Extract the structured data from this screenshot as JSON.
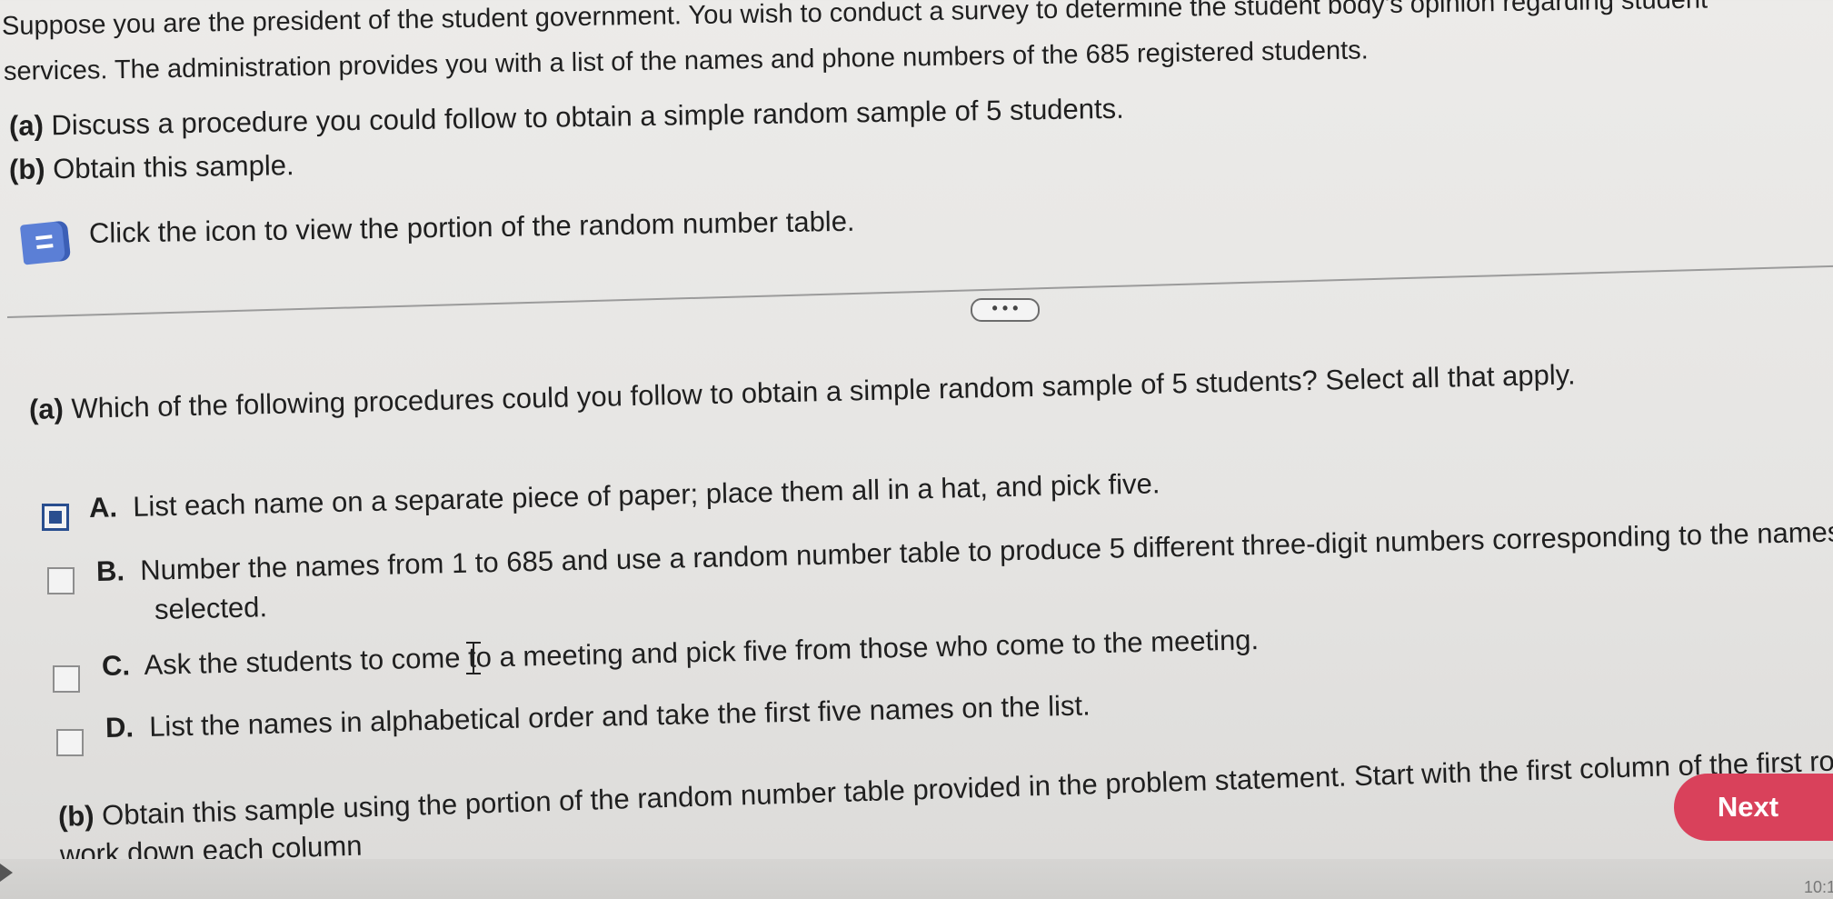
{
  "problem": {
    "line1": "Suppose you are the president of the student government. You wish to conduct a survey to determine the student body's opinion regarding student",
    "line2": "services. The administration provides you with a list of the names and phone numbers of the 685 registered students.",
    "part_a_label": "(a)",
    "part_a_text": "Discuss a procedure you could follow to obtain a simple random sample of 5 students.",
    "part_b_label": "(b)",
    "part_b_text": "Obtain this sample.",
    "icon_prompt": "Click the icon to view the portion of the random number table."
  },
  "divider": {
    "ellipsis": "• • •"
  },
  "question_a": {
    "label": "(a)",
    "text": "Which of the following procedures could you follow to obtain a simple random sample of 5 students? Select all that apply."
  },
  "options": [
    {
      "letter": "A.",
      "text": "List each name on a separate piece of paper; place them all in a hat, and pick five.",
      "checked": true
    },
    {
      "letter": "B.",
      "text_line1": "Number the names from 1 to 685 and use a random number table to produce 5 different three-digit numbers corresponding to the names",
      "text_line2": "selected.",
      "checked": false
    },
    {
      "letter": "C.",
      "text": "Ask the students to come to a meeting and pick five from those who come to the meeting.",
      "checked": false
    },
    {
      "letter": "D.",
      "text": "List the names in alphabetical order and take the first five names on the list.",
      "checked": false
    }
  ],
  "question_b": {
    "label": "(b)",
    "text_line1": "Obtain this sample using the portion of the random number table provided in the problem statement. Start with the first column of the first row and",
    "text_line2": "work down each column"
  },
  "next_button": "Next",
  "status": {
    "time": "10:1"
  },
  "colors": {
    "accent_button": "#d9415b",
    "checkbox_checked": "#294e8f",
    "icon_book": "#5b7fd6"
  }
}
